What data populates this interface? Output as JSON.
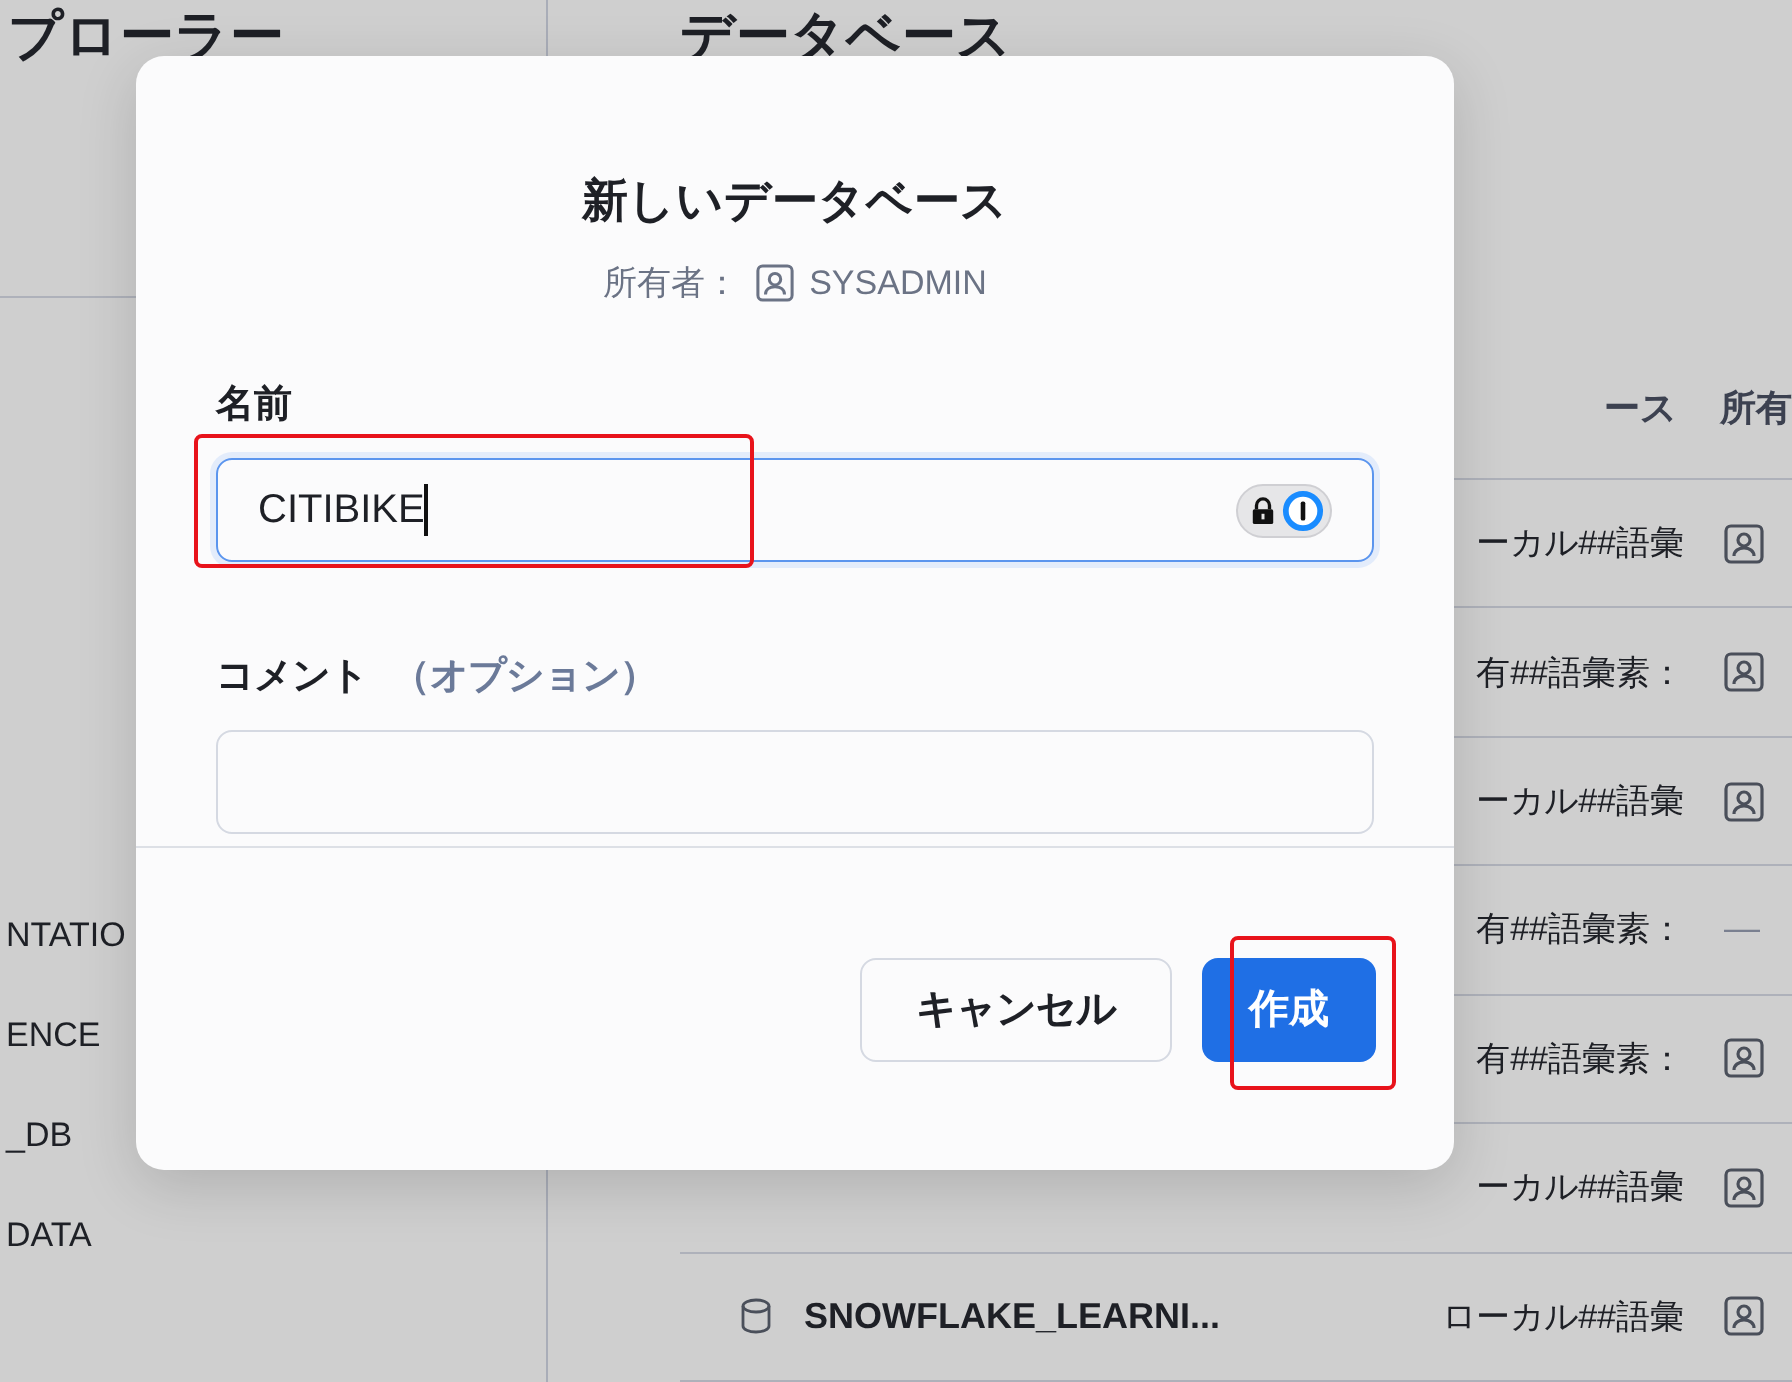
{
  "background": {
    "sidebar": {
      "title": "プローラー",
      "items": [
        "NTATIO",
        "ENCE",
        "_DB",
        "DATA"
      ]
    },
    "main": {
      "title": "データベース",
      "columns": [
        "ース",
        "所有"
      ],
      "rows": [
        {
          "column_2": "ーカル##語彙",
          "owner": {
            "kind": "user"
          }
        },
        {
          "column_2": "有##語彙素：",
          "owner": {
            "kind": "user"
          }
        },
        {
          "column_2": "ーカル##語彙",
          "owner": {
            "kind": "user"
          }
        },
        {
          "column_2": "有##語彙素：",
          "owner": {
            "kind": "text",
            "text": "—"
          }
        },
        {
          "column_2": "有##語彙素：",
          "owner": {
            "kind": "user"
          }
        },
        {
          "column_2": "ーカル##語彙",
          "owner": {
            "kind": "user"
          }
        },
        {
          "name": "SNOWFLAKE_LEARNI...",
          "column_2": "ローカル##語彙",
          "owner": {
            "kind": "user"
          }
        }
      ]
    }
  },
  "dialog": {
    "title": "新しいデータベース",
    "owner_label": "所有者：",
    "owner": "SYSADMIN",
    "fields": [
      {
        "label": "名前",
        "value": "CITIBIKE",
        "focused": true,
        "annotated": true
      },
      {
        "label": "コメント",
        "label_note": "（オプション）",
        "focused": false,
        "annotated": false
      }
    ],
    "buttons": [
      {
        "label": "キャンセル",
        "kind": "secondary",
        "annotated": false
      },
      {
        "label": "作成",
        "kind": "primary",
        "annotated": true
      }
    ]
  }
}
